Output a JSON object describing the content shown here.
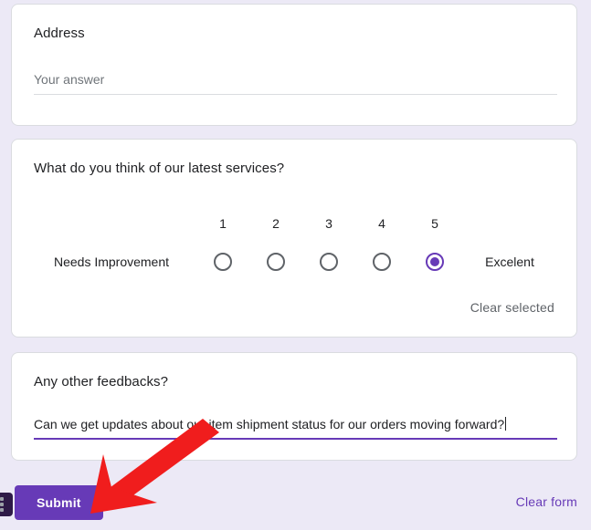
{
  "form": {
    "questions": [
      {
        "id": "address",
        "title": "Address",
        "type": "short-answer",
        "placeholder": "Your answer",
        "value": ""
      },
      {
        "id": "services-rating",
        "title": "What do you think of our latest services?",
        "type": "linear-scale",
        "low_label": "Needs Improvement",
        "high_label": "Excelent",
        "options": [
          "1",
          "2",
          "3",
          "4",
          "5"
        ],
        "selected": "5",
        "clear_label": "Clear selected"
      },
      {
        "id": "other-feedback",
        "title": "Any other feedbacks?",
        "type": "short-answer",
        "value": "Can we get updates about our item shipment status for our orders moving forward?"
      }
    ]
  },
  "footer": {
    "submit_label": "Submit",
    "clear_form_label": "Clear form"
  },
  "overflow_menu": {
    "icon": "more-vert-icon"
  },
  "annotation": {
    "type": "arrow",
    "color": "#f01d1d",
    "points_to": "submit-button"
  },
  "colors": {
    "accent": "#673ab7",
    "page_background": "#ece9f6",
    "card_background": "#ffffff",
    "card_border": "#dadce0",
    "text_primary": "#202124",
    "text_secondary": "#5f6368",
    "placeholder": "#70757a",
    "radio_unselected": "#5f6368",
    "annotation_red": "#f01d1d"
  }
}
